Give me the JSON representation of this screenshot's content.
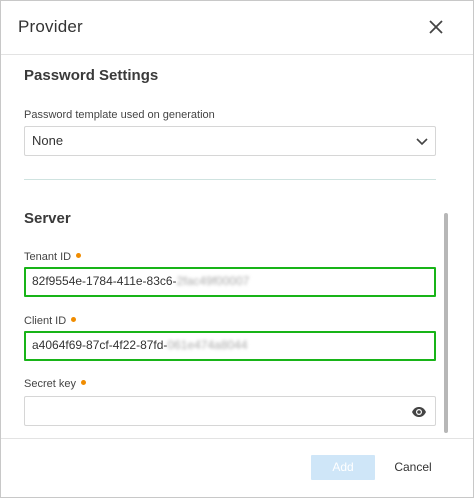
{
  "dialog": {
    "title": "Provider"
  },
  "password_settings": {
    "heading": "Password Settings",
    "template_label": "Password template used on generation",
    "template_value": "None"
  },
  "server": {
    "heading": "Server",
    "tenant_id": {
      "label": "Tenant ID",
      "value_visible": "82f9554e-1784-411e-83c6-",
      "value_obscured": "2fac49f00007"
    },
    "client_id": {
      "label": "Client ID",
      "value_visible": "a4064f69-87cf-4f22-87fd-",
      "value_obscured": "061e474a8044"
    },
    "secret_key": {
      "label": "Secret key",
      "value": ""
    }
  },
  "footer": {
    "add_label": "Add",
    "cancel_label": "Cancel"
  },
  "colors": {
    "required_dot": "#f08c00",
    "highlight_border": "#18b418",
    "add_button_disabled": "#cfe6f8"
  }
}
